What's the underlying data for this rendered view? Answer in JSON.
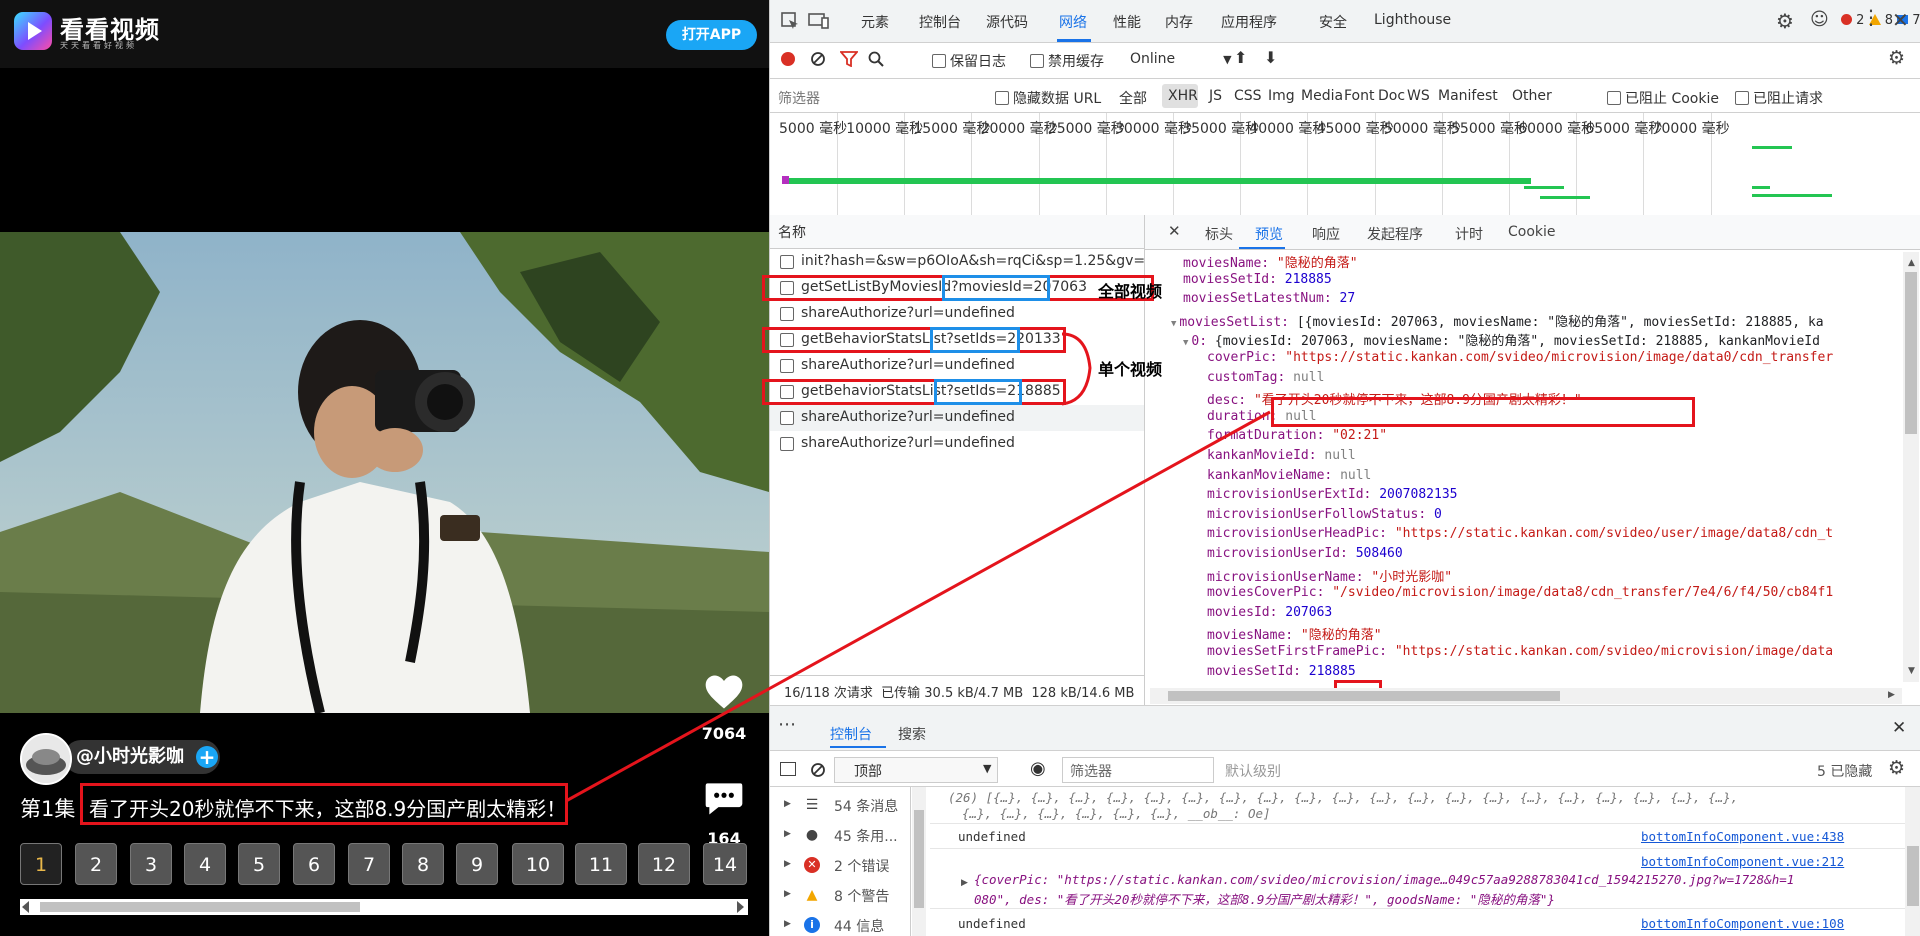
{
  "app": {
    "name": "看看视频",
    "slogan": "天天看看好视频",
    "open_app_button": "打开APP",
    "likes": "7064",
    "comments": "164",
    "author": "@小时光影咖",
    "episode_label": "第1集",
    "video_title": "看了开头20秒就停不下来，这部8.9分国产剧太精彩！",
    "episodes": [
      "1",
      "2",
      "3",
      "4",
      "5",
      "6",
      "7",
      "8",
      "9",
      "10",
      "11",
      "12",
      "14"
    ],
    "active_episode": "1"
  },
  "devtools": {
    "tabs": [
      "元素",
      "控制台",
      "源代码",
      "网络",
      "性能",
      "内存",
      "应用程序",
      "安全",
      "Lighthouse"
    ],
    "active_tab": "网络",
    "badges": {
      "errors": "2",
      "warnings": "8",
      "messages": "7"
    },
    "toolbar": {
      "preserve_log": "保留日志",
      "disable_cache": "禁用缓存",
      "throttle": "Online"
    },
    "filter": {
      "placeholder": "筛选器",
      "hide_data_urls": "隐藏数据 URL",
      "all": "全部",
      "types": [
        "XHR",
        "JS",
        "CSS",
        "Img",
        "Media",
        "Font",
        "Doc",
        "WS",
        "Manifest",
        "Other"
      ],
      "active_type": "XHR",
      "blocked_cookies": "已阻止 Cookie",
      "blocked_requests": "已阻止请求"
    },
    "timeline_ticks": [
      "5000 毫秒",
      "10000 毫秒",
      "15000 毫秒",
      "20000 毫秒",
      "25000 毫秒",
      "30000 毫秒",
      "35000 毫秒",
      "40000 毫秒",
      "45000 毫秒",
      "50000 毫秒",
      "55000 毫秒",
      "60000 毫秒",
      "65000 毫秒",
      "70000 毫秒"
    ],
    "requests_header": "名称",
    "requests": [
      "init?hash=&sw=p6OIoA&sh=rqCi&sp=1.25&gv=w...",
      "getSetListByMoviesId?moviesId=207063",
      "shareAuthorize?url=undefined",
      "getBehaviorStatsList?setIds=220133",
      "shareAuthorize?url=undefined",
      "getBehaviorStatsList?setIds=218885",
      "shareAuthorize?url=undefined",
      "shareAuthorize?url=undefined"
    ],
    "annotations": {
      "all_videos": "全部视频",
      "single_video": "单个视频"
    },
    "status": {
      "requests": "16/118 次请求",
      "transferred": "已传输 30.5 kB/4.7 MB",
      "resources": "128 kB/14.6 MB"
    },
    "detail_tabs": [
      "标头",
      "预览",
      "响应",
      "发起程序",
      "计时",
      "Cookie"
    ],
    "active_detail_tab": "预览",
    "preview": {
      "l1k": "moviesName:",
      "l1v": "\"隐秘的角落\"",
      "l2k": "moviesSetId:",
      "l2v": "218885",
      "l3k": "moviesSetLatestNum:",
      "l3v": "27",
      "l4k": "moviesSetList:",
      "l4v": "[{moviesId: 207063, moviesName: \"隐秘的角落\", moviesSetId: 218885, ka",
      "l5k": "0:",
      "l5v": "{moviesId: 207063, moviesName: \"隐秘的角落\", moviesSetId: 218885, kankanMovieId",
      "l6k": "coverPic:",
      "l6v": "\"https://static.kankan.com/svideo/microvision/image/data0/cdn_transfer",
      "l7k": "customTag:",
      "l7v": "null",
      "l8k": "desc:",
      "l8v": "\"看了开头20秒就停不下来，这部8.9分国产剧太精彩！\"",
      "l9k": "duration:",
      "l9v": "null",
      "l10k": "formatDuration:",
      "l10v": "\"02:21\"",
      "l11k": "kankanMovieId:",
      "l11v": "null",
      "l12k": "kankanMovieName:",
      "l12v": "null",
      "l13k": "microvisionUserExtId:",
      "l13v": "2007082135",
      "l14k": "microvisionUserFollowStatus:",
      "l14v": "0",
      "l15k": "microvisionUserHeadPic:",
      "l15v": "\"https://static.kankan.com/svideo/user/image/data8/cdn_t",
      "l16k": "microvisionUserId:",
      "l16v": "508460",
      "l17k": "microvisionUserName:",
      "l17v": "\"小时光影咖\"",
      "l18k": "moviesCoverPic:",
      "l18v": "\"/svideo/microvision/image/data8/cdn_transfer/7e4/6/f4/50/cb84f1",
      "l19k": "moviesId:",
      "l19v": "207063",
      "l20k": "moviesName:",
      "l20v": "\"隐秘的角落\"",
      "l21k": "moviesSetFirstFramePic:",
      "l21v": "\"https://static.kankan.com/svideo/microvision/image/data",
      "l22k": "moviesSetId:",
      "l22v": "218885"
    },
    "console": {
      "drawer_tabs": [
        "控制台",
        "搜索"
      ],
      "context": "顶部",
      "filter_placeholder": "筛选器",
      "level": "默认级别",
      "hidden": "5 已隐藏",
      "sidebar": [
        "54 条消息",
        "45 条用...",
        "2 个错误",
        "8 个警告",
        "44 信息"
      ],
      "lines": {
        "l1": "(26) [{…}, {…}, {…}, {…}, {…}, {…}, {…}, {…}, {…}, {…}, {…}, {…}, {…}, {…}, {…}, {…}, {…}, {…}, {…}, {…},",
        "l2": "{…}, {…}, {…}, {…}, {…}, {…}, __ob__: Oe]",
        "l3": "undefined",
        "l3src": "bottomInfoComponent.vue:438",
        "l4src": "bottomInfoComponent.vue:212",
        "l4a": "{coverPic: \"https://static.kankan.com/svideo/microvision/image…049c57aa9288783041cd_1594215270.jpg?w=1728&h=1",
        "l4b": "080\", des: \"看了开头20秒就停不下来，这部8.9分国产剧太精彩！\", goodsName: \"隐秘的角落\"}",
        "l5": "undefined",
        "l5src": "bottomInfoComponent.vue:108"
      }
    }
  },
  "colors": {
    "accent": "#1a73e8",
    "annotation_red": "#e4141c",
    "annotation_blue": "#1e8fe8",
    "app_blue": "#1aa6f5"
  }
}
